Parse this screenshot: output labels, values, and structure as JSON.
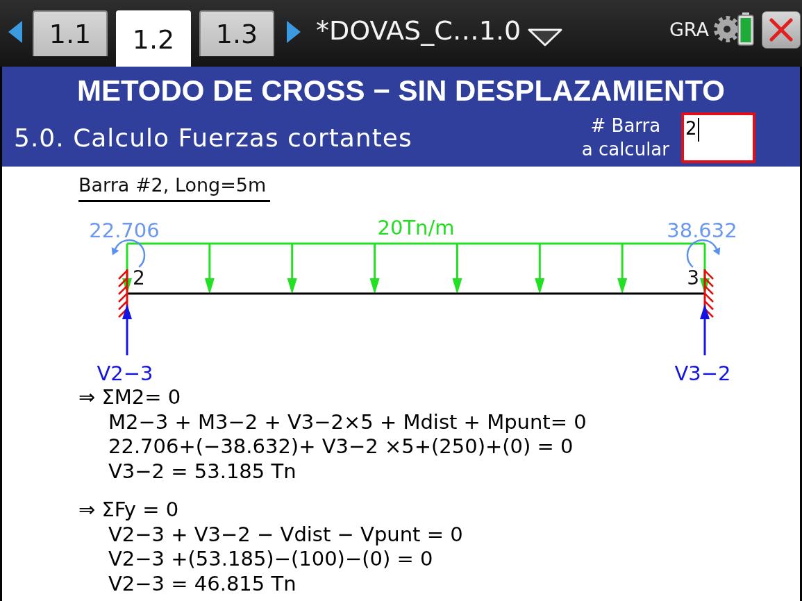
{
  "top_bar": {
    "tabs": [
      {
        "label": "1.1",
        "selected": false
      },
      {
        "label": "1.2",
        "selected": true
      },
      {
        "label": "1.3",
        "selected": false
      }
    ],
    "document_title": "*DOVAS_C…1.0",
    "mode": "GRA"
  },
  "header": {
    "title": "METODO DE CROSS − SIN DESPLAZAMIENTO",
    "subtitle": "5.0. Calculo Fuerzas cortantes",
    "bar_field": {
      "label_lines": [
        "# Barra",
        "a calcular"
      ],
      "value": "2"
    }
  },
  "diagram": {
    "title": "Barra #2, Long=5m",
    "load_label": "20Tn/m",
    "nodes": [
      {
        "label": "2",
        "moment": "22.706",
        "reaction": "V2−3"
      },
      {
        "label": "3",
        "moment": "38.632",
        "reaction": "V3−2"
      }
    ]
  },
  "equation_blocks": [
    {
      "heading": "⇒ ΣM2= 0",
      "lines": [
        "M2−3 + M3−2 + V3−2×5 + Mdist + Mpunt= 0",
        "22.706+(−38.632)+ V3−2 ×5+(250)+(0) = 0",
        "V3−2 = 53.185 Tn"
      ]
    },
    {
      "heading": "⇒ ΣFy = 0",
      "lines": [
        "V2−3 + V3−2 − Vdist − Vpunt = 0",
        "V2−3 +(53.185)−(100)−(0) = 0",
        "V2−3 = 46.815 Tn"
      ]
    }
  ]
}
